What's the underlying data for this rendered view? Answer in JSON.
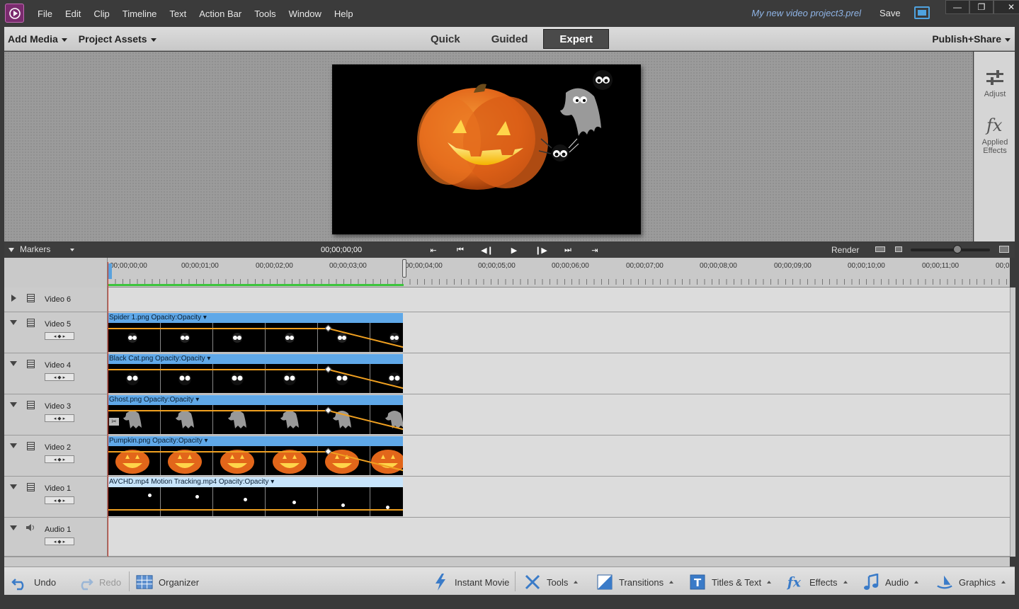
{
  "window": {
    "project_name": "My new video project3.prel",
    "save_label": "Save",
    "min": "—",
    "max": "❐",
    "close": "✕"
  },
  "menu": [
    "File",
    "Edit",
    "Clip",
    "Timeline",
    "Text",
    "Action Bar",
    "Tools",
    "Window",
    "Help"
  ],
  "modebar": {
    "add_media": "Add Media",
    "project_assets": "Project Assets",
    "tabs": [
      "Quick",
      "Guided",
      "Expert"
    ],
    "active_tab": "Expert",
    "publish": "Publish+Share"
  },
  "right_panel": {
    "adjust": "Adjust",
    "applied_effects_1": "Applied",
    "applied_effects_2": "Effects"
  },
  "transport": {
    "markers": "Markers",
    "timecode": "00;00;00;00",
    "render": "Render"
  },
  "ruler": {
    "labels": [
      "00;00;00;00",
      "00;00;01;00",
      "00;00;02;00",
      "00;00;03;00",
      "00;00;04;00",
      "00;00;05;00",
      "00;00;06;00",
      "00;00;07;00",
      "00;00;08;00",
      "00;00;09;00",
      "00;00;10;00",
      "00;00;11;00",
      "00;0"
    ]
  },
  "tracks": [
    {
      "name": "Video 6",
      "type": "video",
      "collapsed": true
    },
    {
      "name": "Video 5",
      "type": "video",
      "clip": "Spider 1.png  Opacity:Opacity ▾"
    },
    {
      "name": "Video 4",
      "type": "video",
      "clip": "Black Cat.png  Opacity:Opacity ▾"
    },
    {
      "name": "Video 3",
      "type": "video",
      "clip": "Ghost.png  Opacity:Opacity ▾"
    },
    {
      "name": "Video 2",
      "type": "video",
      "clip": "Pumpkin.png  Opacity:Opacity ▾"
    },
    {
      "name": "Video 1",
      "type": "video",
      "clip": "AVCHD.mp4 Motion Tracking.mp4  Opacity:Opacity ▾"
    },
    {
      "name": "Audio 1",
      "type": "audio"
    }
  ],
  "actionbar": {
    "undo": "Undo",
    "redo": "Redo",
    "organizer": "Organizer",
    "instant_movie": "Instant Movie",
    "tools": "Tools",
    "transitions": "Transitions",
    "titles_text": "Titles & Text",
    "effects": "Effects",
    "audio": "Audio",
    "graphics": "Graphics"
  },
  "colors": {
    "clip_header": "#5fa8e8",
    "opacity_line": "#f0a020",
    "playhead": "#d23b2b",
    "work_area": "#3cc43c",
    "project_name": "#8fb4e6"
  },
  "icons": {
    "app_logo": "premiere-elements-logo-icon",
    "adjust": "sliders-icon",
    "applied_effects": "fx-icon",
    "undo": "undo-arrow-icon",
    "redo": "redo-arrow-icon",
    "organizer": "grid-icon",
    "instant_movie": "lightning-icon",
    "tools": "tools-icon",
    "transitions": "transition-icon",
    "titles_text": "titles-icon",
    "effects": "fx-icon",
    "audio": "music-note-icon",
    "graphics": "graphics-icon"
  }
}
